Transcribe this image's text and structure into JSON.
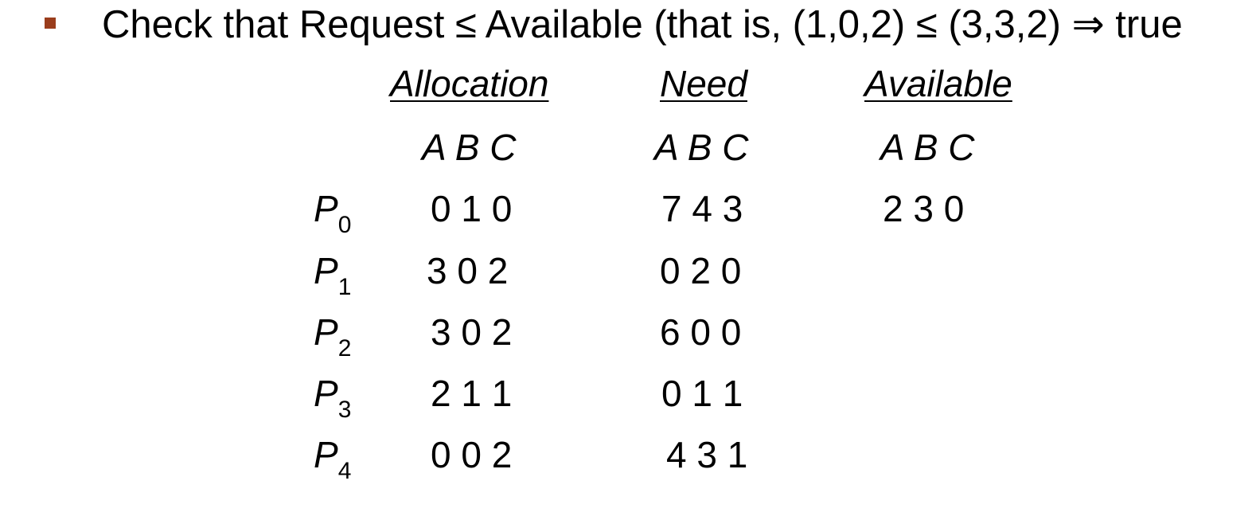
{
  "statement": "Check that Request ≤ Available (that is, (1,0,2) ≤ (3,3,2) ⇒ true",
  "bullet_color": "#9a3d1c",
  "headers": {
    "allocation": "Allocation",
    "need": "Need",
    "available": "Available"
  },
  "subheaders": {
    "allocation": "A B C",
    "need": "A B C",
    "available": "A B C"
  },
  "rows": [
    {
      "proc": "P",
      "sub": "0",
      "allocation": "0 1 0",
      "need": "7 4 3",
      "available": "2 3 0"
    },
    {
      "proc": "P",
      "sub": "1",
      "allocation": "3 0 2",
      "need": "0 2 0"
    },
    {
      "proc": "P",
      "sub": "2",
      "allocation": "3 0 2",
      "need": "6 0 0"
    },
    {
      "proc": "P",
      "sub": "3",
      "allocation": "2 1 1",
      "need": "0 1 1"
    },
    {
      "proc": "P",
      "sub": "4",
      "allocation": "0 0 2",
      "need": "4 3 1"
    }
  ]
}
